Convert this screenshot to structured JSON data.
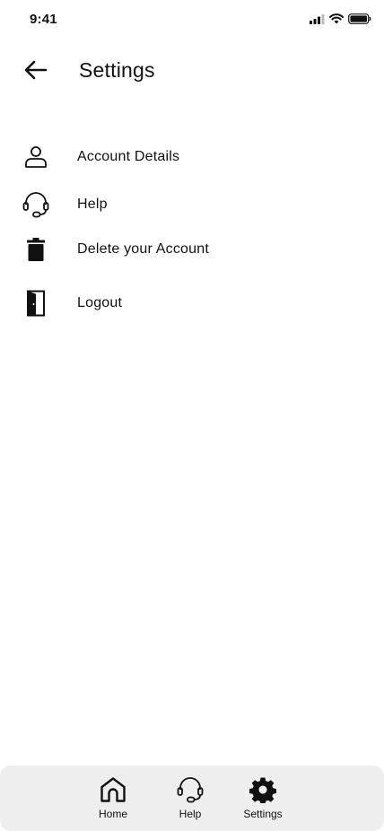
{
  "status_bar": {
    "time": "9:41"
  },
  "header": {
    "title": "Settings"
  },
  "menu": {
    "items": [
      {
        "label": "Account Details",
        "icon": "person-icon"
      },
      {
        "label": "Help",
        "icon": "headset-icon"
      },
      {
        "label": "Delete your Account",
        "icon": "trash-icon"
      },
      {
        "label": "Logout",
        "icon": "door-icon"
      }
    ]
  },
  "tab_bar": {
    "tabs": [
      {
        "label": "Home",
        "icon": "home-icon"
      },
      {
        "label": "Help",
        "icon": "headset-icon"
      },
      {
        "label": "Settings",
        "icon": "gear-icon"
      }
    ]
  }
}
